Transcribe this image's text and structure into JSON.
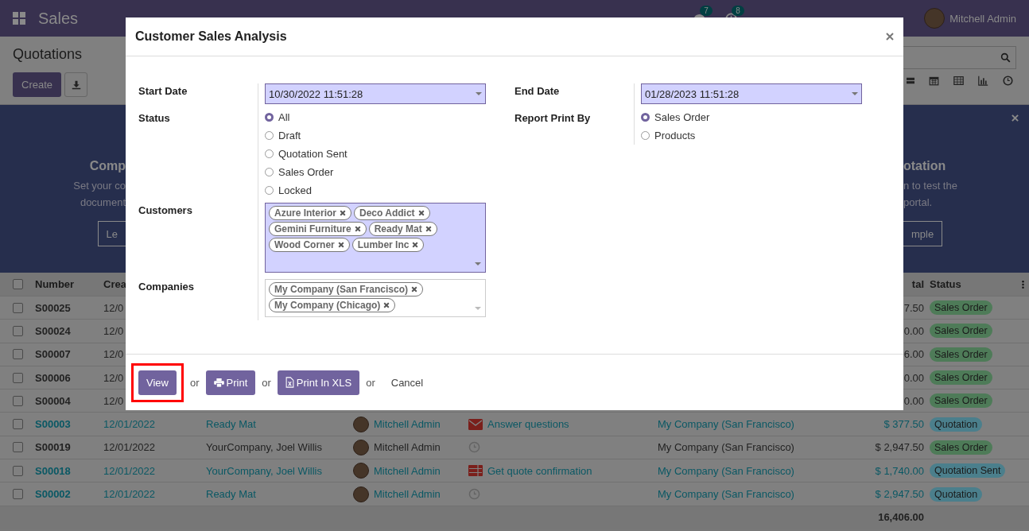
{
  "navbar": {
    "app": "Sales",
    "chat_badge": "7",
    "activity_badge": "8",
    "user": "Mitchell Admin"
  },
  "control_panel": {
    "title": "Quotations",
    "create": "Create"
  },
  "banner": {
    "left": {
      "title": "Comp",
      "lines": [
        "Set your co",
        "document"
      ],
      "button": "Le"
    },
    "right": {
      "title": "otation",
      "lines": [
        "n to test the",
        "portal."
      ],
      "button": "mple"
    }
  },
  "table": {
    "headers": {
      "number": "Number",
      "created": "Crea",
      "total": "tal",
      "status": "Status"
    },
    "select_all_checked": false,
    "rows": [
      {
        "number": "S00025",
        "created": "12/0",
        "total": "7.50",
        "status": "Sales Order",
        "color": "#4e7b58",
        "info": false,
        "checked": false
      },
      {
        "number": "S00024",
        "created": "12/0",
        "total": "0.00",
        "status": "Sales Order",
        "color": "#4e7b58",
        "info": false,
        "checked": false
      },
      {
        "number": "S00007",
        "created": "12/0",
        "total": "6.00",
        "status": "Sales Order",
        "color": "#4e7b58",
        "info": false,
        "checked": false
      },
      {
        "number": "S00006",
        "created": "12/0",
        "total": "0.00",
        "status": "Sales Order",
        "color": "#4e7b58",
        "info": false,
        "checked": false
      },
      {
        "number": "S00004",
        "created": "12/0",
        "total": "0.00",
        "status": "Sales Order",
        "color": "#4e7b58",
        "info": false,
        "checked": false
      },
      {
        "number": "S00003",
        "created": "12/01/2022",
        "customer": "Ready Mat",
        "salesperson": "Mitchell Admin",
        "kind": "email",
        "activity": "Answer questions",
        "company": "My Company (San Francisco)",
        "total": "$ 377.50",
        "status": "Quotation",
        "color": "#4b7f8c",
        "info": true,
        "checked": false
      },
      {
        "number": "S00019",
        "created": "12/01/2022",
        "customer": "YourCompany, Joel Willis",
        "salesperson": "Mitchell Admin",
        "kind": "none",
        "company": "My Company (San Francisco)",
        "total": "$ 2,947.50",
        "status": "Sales Order",
        "color": "#4e7b58",
        "info": false,
        "checked": false
      },
      {
        "number": "S00018",
        "created": "12/01/2022",
        "customer": "YourCompany, Joel Willis",
        "salesperson": "Mitchell Admin",
        "kind": "todo",
        "activity": "Get quote confirmation",
        "company": "My Company (San Francisco)",
        "total": "$ 1,740.00",
        "status": "Quotation Sent",
        "color": "#4b7f8c",
        "info": true,
        "checked": false
      },
      {
        "number": "S00002",
        "created": "12/01/2022",
        "customer": "Ready Mat",
        "salesperson": "Mitchell Admin",
        "kind": "none",
        "company": "My Company (San Francisco)",
        "total": "$ 2,947.50",
        "status": "Quotation",
        "color": "#4b7f8c",
        "info": true,
        "checked": false
      }
    ],
    "footer_total": "16,406.00"
  },
  "dialog": {
    "title": "Customer Sales Analysis",
    "start_date": {
      "label": "Start Date",
      "value": "10/30/2022 11:51:28",
      "required": true
    },
    "end_date": {
      "label": "End Date",
      "value": "01/28/2023 11:51:28",
      "required": true
    },
    "status": {
      "label": "Status",
      "options": [
        {
          "label": "All",
          "selected": true
        },
        {
          "label": "Draft",
          "selected": false
        },
        {
          "label": "Quotation Sent",
          "selected": false
        },
        {
          "label": "Sales Order",
          "selected": false
        },
        {
          "label": "Locked",
          "selected": false
        }
      ]
    },
    "report_print_by": {
      "label": "Report Print By",
      "options": [
        {
          "label": "Sales Order",
          "selected": true
        },
        {
          "label": "Products",
          "selected": false
        }
      ]
    },
    "customers": {
      "label": "Customers",
      "required": true,
      "tags": [
        "Azure Interior",
        "Deco Addict",
        "Gemini Furniture",
        "Ready Mat",
        "Wood Corner",
        "Lumber Inc"
      ]
    },
    "companies": {
      "label": "Companies",
      "required": false,
      "tags": [
        "My Company (San Francisco)",
        "My Company (Chicago)"
      ]
    },
    "footer": [
      {
        "kind": "plain",
        "label": "View",
        "highlighted": true
      },
      {
        "kind": "text",
        "label": "or"
      },
      {
        "kind": "print",
        "label": "Print",
        "highlighted": false
      },
      {
        "kind": "text",
        "label": "or"
      },
      {
        "kind": "xls",
        "label": "Print In XLS",
        "highlighted": false
      },
      {
        "kind": "text",
        "label": "or"
      },
      {
        "kind": "link",
        "label": "Cancel"
      }
    ]
  }
}
